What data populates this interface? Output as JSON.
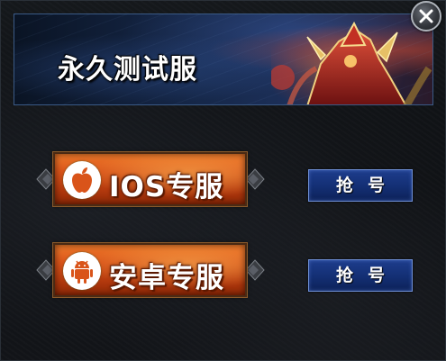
{
  "banner": {
    "title": "永久测试服"
  },
  "buttons": [
    {
      "label": "IOS专服",
      "icon": "apple-icon",
      "grab_label": "抢号"
    },
    {
      "label": "安卓专服",
      "icon": "android-icon",
      "grab_label": "抢号"
    }
  ],
  "colors": {
    "orange_button": "#d9541a",
    "blue_button": "#143076",
    "banner_border": "#3a5a86"
  }
}
